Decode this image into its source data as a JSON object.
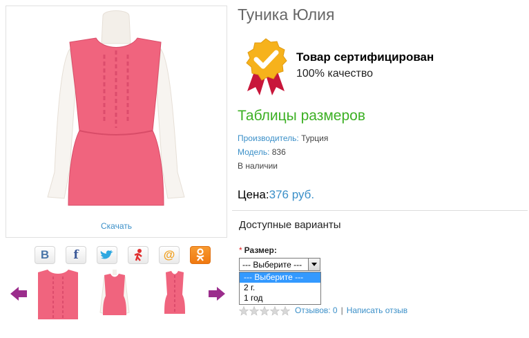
{
  "product": {
    "title": "Туника Юлия",
    "download_label": "Скачать"
  },
  "certificate": {
    "title": "Товар сертифицирован",
    "subtitle": "100% качество",
    "icon": "certified-badge-icon"
  },
  "size_tables_link": "Таблицы размеров",
  "details": {
    "manufacturer_label": "Производитель:",
    "manufacturer_value": "Турция",
    "model_label": "Модель:",
    "model_value": "836",
    "availability": "В наличии"
  },
  "price": {
    "label": "Цена:",
    "value": "376 руб."
  },
  "options": {
    "title": "Доступные варианты",
    "size_label": "Размер:",
    "required_mark": "*",
    "selected": "--- Выберите ---",
    "items": [
      "--- Выберите ---",
      "2 г.",
      "1 год"
    ]
  },
  "reviews": {
    "rating_stars": 0,
    "max_stars": 5,
    "reviews_link": "Отзывов: 0",
    "separator": "|",
    "write_review": "Написать отзыв"
  },
  "social": [
    {
      "name": "vk",
      "glyph": "В",
      "color": "#4a76a8"
    },
    {
      "name": "facebook",
      "glyph": "f",
      "color": "#3b5998"
    },
    {
      "name": "twitter",
      "glyph": "🐦",
      "color": "#2fa8e0"
    },
    {
      "name": "yaru",
      "glyph": "Я",
      "color": "#e03030"
    },
    {
      "name": "mailru",
      "glyph": "@",
      "color": "#f0a020"
    },
    {
      "name": "odnoklassniki",
      "glyph": "ок",
      "color": "#f58220"
    }
  ],
  "colors": {
    "accent_link": "#3a8fc8",
    "size_tables": "#3cb024",
    "garment_pink": "#f05a78",
    "arrow_purple": "#9b2d8c",
    "dropdown_selected": "#3399ff"
  }
}
